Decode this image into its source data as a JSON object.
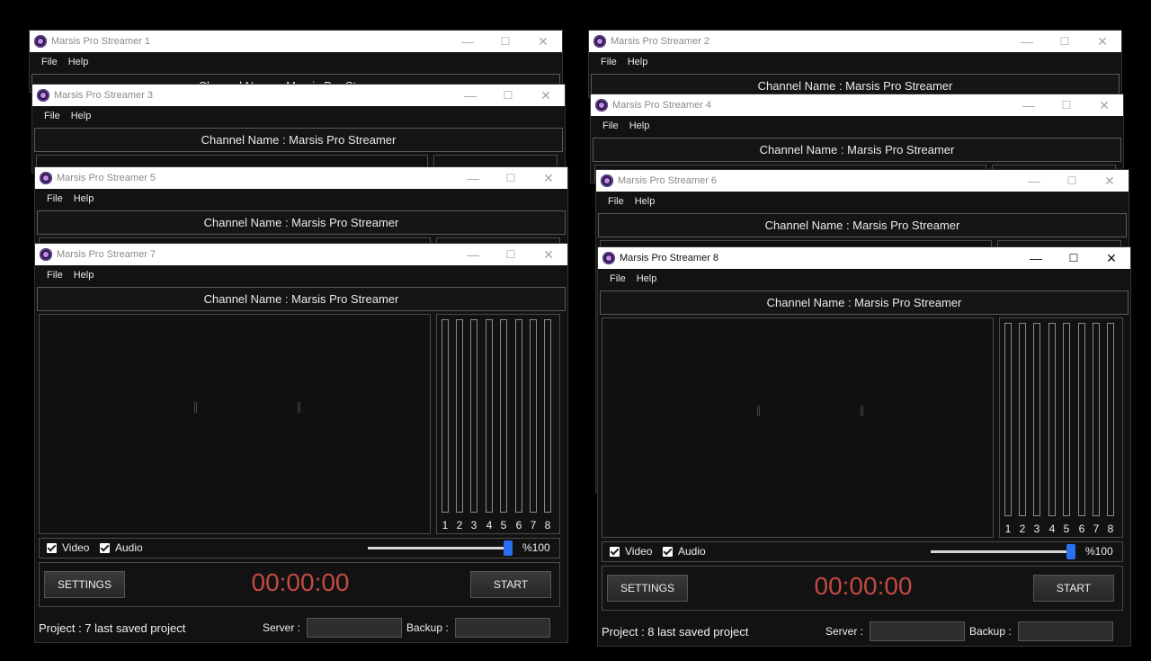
{
  "colors": {
    "timer": "#c24a42",
    "slider_thumb": "#2a6ff0",
    "background": "#000000"
  },
  "titlebar_buttons": {
    "minimize": "—",
    "maximize": "☐",
    "close": "✕"
  },
  "menu": {
    "file": "File",
    "help": "Help"
  },
  "windows": [
    {
      "title": "Marsis Pro Streamer 1",
      "channel": "Channel Name : Marsis Pro Streamer"
    },
    {
      "title": "Marsis Pro Streamer 2",
      "channel": "Channel Name : Marsis Pro Streamer"
    },
    {
      "title": "Marsis Pro Streamer 3",
      "channel": "Channel Name : Marsis Pro Streamer"
    },
    {
      "title": "Marsis Pro Streamer 4",
      "channel": "Channel Name : Marsis Pro Streamer"
    },
    {
      "title": "Marsis Pro Streamer 5",
      "channel": "Channel Name : Marsis Pro Streamer"
    },
    {
      "title": "Marsis Pro Streamer 6",
      "channel": "Channel Name : Marsis Pro Streamer"
    },
    {
      "title": "Marsis Pro Streamer 7",
      "channel": "Channel Name : Marsis Pro Streamer",
      "meter_labels": [
        "1",
        "2",
        "3",
        "4",
        "5",
        "6",
        "7",
        "8"
      ],
      "video_label": "Video",
      "video_checked": true,
      "audio_label": "Audio",
      "audio_checked": true,
      "volume": 100,
      "volume_label": "%100",
      "settings_label": "SETTINGS",
      "start_label": "START",
      "timer": "00:00:00",
      "project": "Project : 7 last saved project",
      "server_label": "Server :",
      "backup_label": "Backup :"
    },
    {
      "title": "Marsis Pro Streamer 8",
      "channel": "Channel Name : Marsis Pro Streamer",
      "meter_labels": [
        "1",
        "2",
        "3",
        "4",
        "5",
        "6",
        "7",
        "8"
      ],
      "video_label": "Video",
      "video_checked": true,
      "audio_label": "Audio",
      "audio_checked": true,
      "volume": 100,
      "volume_label": "%100",
      "settings_label": "SETTINGS",
      "start_label": "START",
      "timer": "00:00:00",
      "project": "Project : 8 last saved project",
      "server_label": "Server :",
      "backup_label": "Backup :"
    }
  ]
}
